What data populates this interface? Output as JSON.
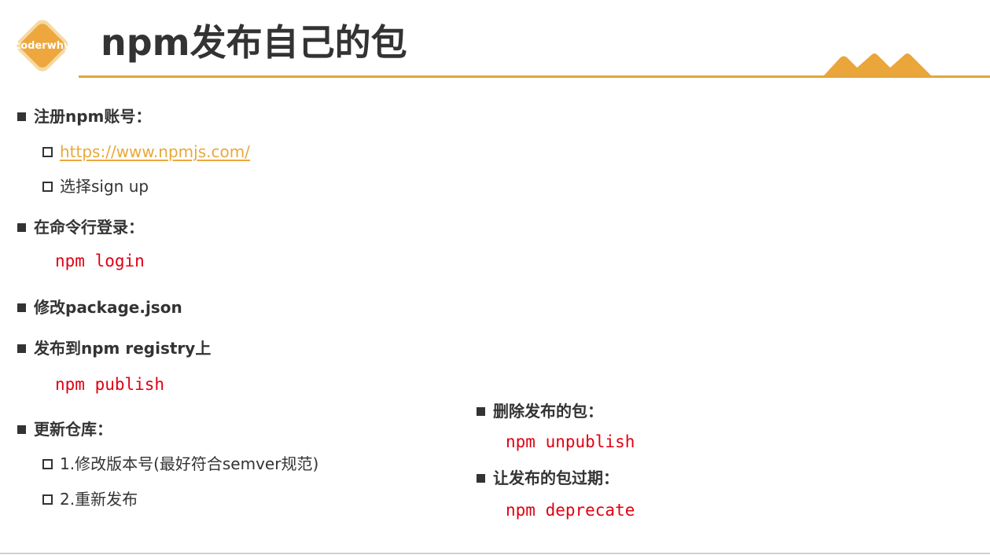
{
  "header": {
    "logo_text": "coderwhy",
    "title": "npm发布自己的包"
  },
  "colors": {
    "accent": "#e8a93a",
    "code": "#e00012",
    "text": "#333333"
  },
  "left": {
    "register": {
      "label": "注册npm账号：",
      "link": "https://www.npmjs.com/",
      "step": "选择sign up"
    },
    "login": {
      "label": "在命令行登录：",
      "code": "npm login"
    },
    "modify": {
      "label": "修改package.json"
    },
    "publish": {
      "label": "发布到npm registry上",
      "code": "npm publish"
    },
    "update": {
      "label": "更新仓库：",
      "steps": [
        "1.修改版本号(最好符合semver规范)",
        "2.重新发布"
      ]
    }
  },
  "right": {
    "unpublish": {
      "label": "删除发布的包：",
      "code": "npm unpublish"
    },
    "deprecate": {
      "label": "让发布的包过期：",
      "code": "npm deprecate"
    }
  }
}
